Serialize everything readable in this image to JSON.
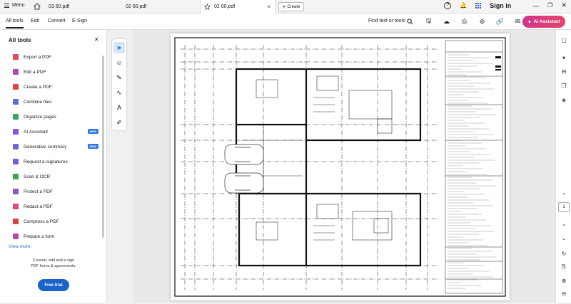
{
  "topbar": {
    "menu_label": "Menu",
    "tabs": [
      {
        "label": "03 60.pdf"
      },
      {
        "label": "02 60.pdf"
      },
      {
        "label": "02 60.pdf"
      }
    ],
    "create_label": "Create",
    "sign_in_label": "Sign in"
  },
  "toolbar": {
    "nav_tabs": [
      "All tools",
      "Edit",
      "Convert",
      "E-Sign"
    ],
    "find_label": "Find text or tools",
    "ai_assistant_label": "AI Assistant"
  },
  "left_panel": {
    "title": "All tools",
    "tools": [
      {
        "label": "Export a PDF",
        "color": "#e04b5a"
      },
      {
        "label": "Edit a PDF",
        "color": "#b846b8"
      },
      {
        "label": "Create a PDF",
        "color": "#e0443e"
      },
      {
        "label": "Combine files",
        "color": "#5b6fe0"
      },
      {
        "label": "Organize pages",
        "color": "#3aa65a"
      },
      {
        "label": "AI Assistant",
        "color": "#8a56d8",
        "badge": "NEW"
      },
      {
        "label": "Generative summary",
        "color": "#6a6ad8",
        "badge": "NEW"
      },
      {
        "label": "Request e-signatures",
        "color": "#7a5cd8"
      },
      {
        "label": "Scan & OCR",
        "color": "#3aa65a"
      },
      {
        "label": "Protect a PDF",
        "color": "#8a56d8"
      },
      {
        "label": "Redact a PDF",
        "color": "#e04b7a"
      },
      {
        "label": "Compress a PDF",
        "color": "#d8443e"
      },
      {
        "label": "Prepare a form",
        "color": "#b846b8"
      }
    ],
    "view_more_label": "View more",
    "promo_text_line1": "Convert, edit and e-sign",
    "promo_text_line2": "PDF forms & agreements.",
    "free_trial_label": "Free trial"
  },
  "right_rail": {
    "page_number": "1"
  }
}
